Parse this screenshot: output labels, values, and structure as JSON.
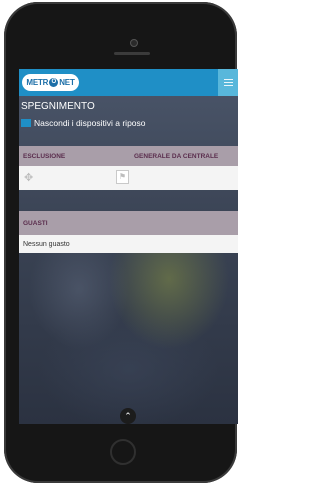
{
  "app": {
    "logo_text_left": "METR",
    "logo_text_mid": "O",
    "logo_text_right": "NET"
  },
  "page": {
    "title": "SPEGNIMENTO",
    "toggle_label": "Nascondi i dispositivi a riposo"
  },
  "exclusion": {
    "col1": "ESCLUSIONE",
    "col2": "GENERALE DA CENTRALE",
    "tool_icon": "✥",
    "flag_icon": "⚑"
  },
  "faults": {
    "header": "GUASTI",
    "empty_text": "Nessun guasto"
  },
  "footer": {
    "chevron": "⌃"
  },
  "colors": {
    "appbar": "#1f8fc6",
    "section_header": "#a99ea9",
    "section_text": "#5a2d4d"
  }
}
